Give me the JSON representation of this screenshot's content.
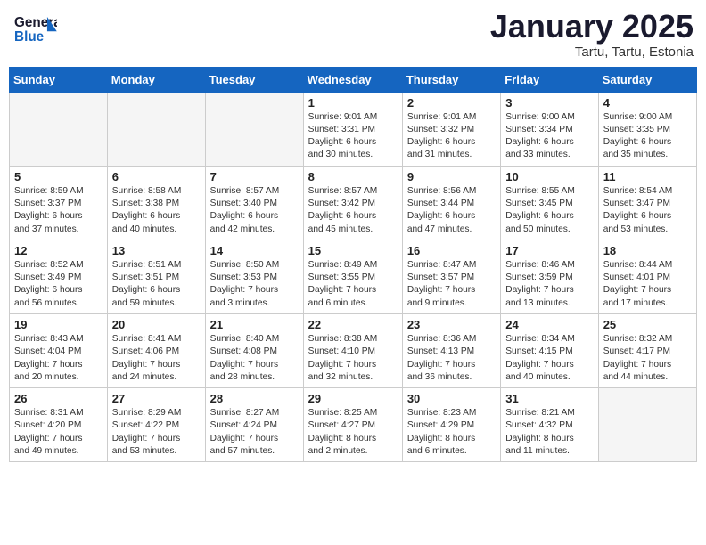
{
  "logo": {
    "line1": "General",
    "line2": "Blue"
  },
  "title": "January 2025",
  "location": "Tartu, Tartu, Estonia",
  "weekdays": [
    "Sunday",
    "Monday",
    "Tuesday",
    "Wednesday",
    "Thursday",
    "Friday",
    "Saturday"
  ],
  "weeks": [
    [
      {
        "day": "",
        "info": ""
      },
      {
        "day": "",
        "info": ""
      },
      {
        "day": "",
        "info": ""
      },
      {
        "day": "1",
        "info": "Sunrise: 9:01 AM\nSunset: 3:31 PM\nDaylight: 6 hours\nand 30 minutes."
      },
      {
        "day": "2",
        "info": "Sunrise: 9:01 AM\nSunset: 3:32 PM\nDaylight: 6 hours\nand 31 minutes."
      },
      {
        "day": "3",
        "info": "Sunrise: 9:00 AM\nSunset: 3:34 PM\nDaylight: 6 hours\nand 33 minutes."
      },
      {
        "day": "4",
        "info": "Sunrise: 9:00 AM\nSunset: 3:35 PM\nDaylight: 6 hours\nand 35 minutes."
      }
    ],
    [
      {
        "day": "5",
        "info": "Sunrise: 8:59 AM\nSunset: 3:37 PM\nDaylight: 6 hours\nand 37 minutes."
      },
      {
        "day": "6",
        "info": "Sunrise: 8:58 AM\nSunset: 3:38 PM\nDaylight: 6 hours\nand 40 minutes."
      },
      {
        "day": "7",
        "info": "Sunrise: 8:57 AM\nSunset: 3:40 PM\nDaylight: 6 hours\nand 42 minutes."
      },
      {
        "day": "8",
        "info": "Sunrise: 8:57 AM\nSunset: 3:42 PM\nDaylight: 6 hours\nand 45 minutes."
      },
      {
        "day": "9",
        "info": "Sunrise: 8:56 AM\nSunset: 3:44 PM\nDaylight: 6 hours\nand 47 minutes."
      },
      {
        "day": "10",
        "info": "Sunrise: 8:55 AM\nSunset: 3:45 PM\nDaylight: 6 hours\nand 50 minutes."
      },
      {
        "day": "11",
        "info": "Sunrise: 8:54 AM\nSunset: 3:47 PM\nDaylight: 6 hours\nand 53 minutes."
      }
    ],
    [
      {
        "day": "12",
        "info": "Sunrise: 8:52 AM\nSunset: 3:49 PM\nDaylight: 6 hours\nand 56 minutes."
      },
      {
        "day": "13",
        "info": "Sunrise: 8:51 AM\nSunset: 3:51 PM\nDaylight: 6 hours\nand 59 minutes."
      },
      {
        "day": "14",
        "info": "Sunrise: 8:50 AM\nSunset: 3:53 PM\nDaylight: 7 hours\nand 3 minutes."
      },
      {
        "day": "15",
        "info": "Sunrise: 8:49 AM\nSunset: 3:55 PM\nDaylight: 7 hours\nand 6 minutes."
      },
      {
        "day": "16",
        "info": "Sunrise: 8:47 AM\nSunset: 3:57 PM\nDaylight: 7 hours\nand 9 minutes."
      },
      {
        "day": "17",
        "info": "Sunrise: 8:46 AM\nSunset: 3:59 PM\nDaylight: 7 hours\nand 13 minutes."
      },
      {
        "day": "18",
        "info": "Sunrise: 8:44 AM\nSunset: 4:01 PM\nDaylight: 7 hours\nand 17 minutes."
      }
    ],
    [
      {
        "day": "19",
        "info": "Sunrise: 8:43 AM\nSunset: 4:04 PM\nDaylight: 7 hours\nand 20 minutes."
      },
      {
        "day": "20",
        "info": "Sunrise: 8:41 AM\nSunset: 4:06 PM\nDaylight: 7 hours\nand 24 minutes."
      },
      {
        "day": "21",
        "info": "Sunrise: 8:40 AM\nSunset: 4:08 PM\nDaylight: 7 hours\nand 28 minutes."
      },
      {
        "day": "22",
        "info": "Sunrise: 8:38 AM\nSunset: 4:10 PM\nDaylight: 7 hours\nand 32 minutes."
      },
      {
        "day": "23",
        "info": "Sunrise: 8:36 AM\nSunset: 4:13 PM\nDaylight: 7 hours\nand 36 minutes."
      },
      {
        "day": "24",
        "info": "Sunrise: 8:34 AM\nSunset: 4:15 PM\nDaylight: 7 hours\nand 40 minutes."
      },
      {
        "day": "25",
        "info": "Sunrise: 8:32 AM\nSunset: 4:17 PM\nDaylight: 7 hours\nand 44 minutes."
      }
    ],
    [
      {
        "day": "26",
        "info": "Sunrise: 8:31 AM\nSunset: 4:20 PM\nDaylight: 7 hours\nand 49 minutes."
      },
      {
        "day": "27",
        "info": "Sunrise: 8:29 AM\nSunset: 4:22 PM\nDaylight: 7 hours\nand 53 minutes."
      },
      {
        "day": "28",
        "info": "Sunrise: 8:27 AM\nSunset: 4:24 PM\nDaylight: 7 hours\nand 57 minutes."
      },
      {
        "day": "29",
        "info": "Sunrise: 8:25 AM\nSunset: 4:27 PM\nDaylight: 8 hours\nand 2 minutes."
      },
      {
        "day": "30",
        "info": "Sunrise: 8:23 AM\nSunset: 4:29 PM\nDaylight: 8 hours\nand 6 minutes."
      },
      {
        "day": "31",
        "info": "Sunrise: 8:21 AM\nSunset: 4:32 PM\nDaylight: 8 hours\nand 11 minutes."
      },
      {
        "day": "",
        "info": ""
      }
    ]
  ]
}
